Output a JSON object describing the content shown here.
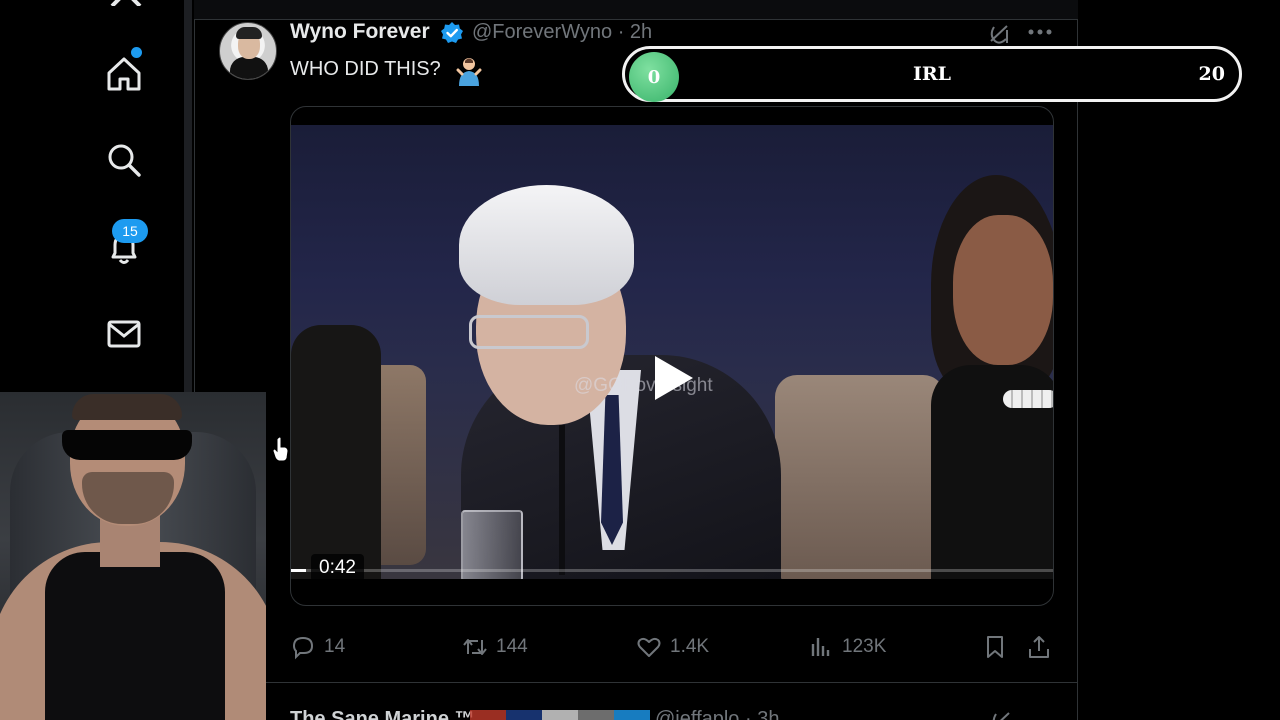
{
  "nav": {
    "items": [
      {
        "name": "home",
        "icon": "home-icon"
      },
      {
        "name": "explore",
        "icon": "search-icon"
      },
      {
        "name": "notifications",
        "icon": "bell-icon",
        "badge": "15"
      },
      {
        "name": "messages",
        "icon": "mail-icon"
      }
    ],
    "notification_badge": "15",
    "accent_color": "#1d9bf0"
  },
  "tweet": {
    "author_name": "Wyno Forever",
    "handle_time": "@ForeverWyno · 2h",
    "text": "WHO DID THIS?",
    "video": {
      "duration": "0:42",
      "watermark": "@GOPoversight",
      "progress_fraction": 0.02
    },
    "actions": {
      "replies": "14",
      "reposts": "144",
      "likes": "1.4K",
      "views": "123K"
    }
  },
  "next_tweet": {
    "name": "The Sane Marine ™",
    "handle_time": "@jeffaplo · 3h"
  },
  "overlay": {
    "goal_current": "0",
    "goal_label": "IRL",
    "goal_target": "20",
    "goal_color": "#38b36a"
  }
}
